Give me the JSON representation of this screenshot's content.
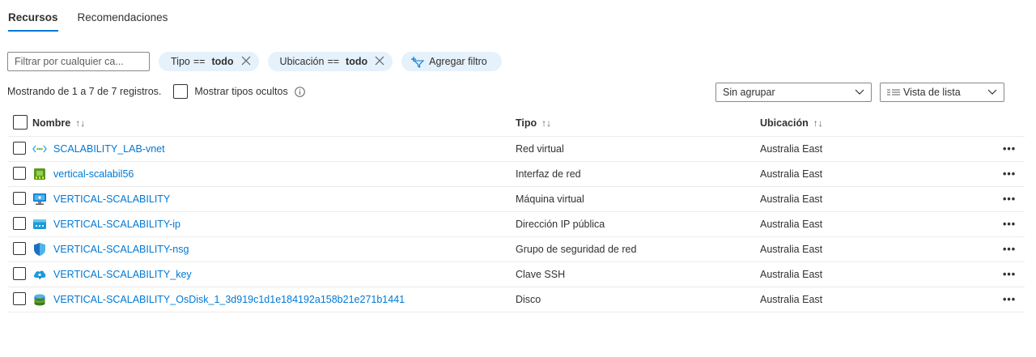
{
  "tabs": [
    {
      "label": "Recursos",
      "active": true
    },
    {
      "label": "Recomendaciones",
      "active": false
    }
  ],
  "filters": {
    "search_placeholder": "Filtrar por cualquier ca...",
    "pills": [
      {
        "key": "Tipo",
        "op": "==",
        "value": "todo"
      },
      {
        "key": "Ubicación",
        "op": "==",
        "value": "todo"
      }
    ],
    "add_filter_label": "Agregar filtro"
  },
  "summary": {
    "count_text": "Mostrando de 1 a 7 de 7 registros.",
    "show_hidden_label": "Mostrar tipos ocultos"
  },
  "grouping": {
    "selected": "Sin agrupar"
  },
  "view": {
    "selected": "Vista de lista"
  },
  "table": {
    "columns": [
      {
        "label": "Nombre",
        "sort": "↑↓"
      },
      {
        "label": "Tipo",
        "sort": "↑↓"
      },
      {
        "label": "Ubicación",
        "sort": "↑↓"
      }
    ],
    "rows": [
      {
        "name": "SCALABILITY_LAB-vnet",
        "type": "Red virtual",
        "location": "Australia East",
        "icon": "virtual-network-icon",
        "more": "•••"
      },
      {
        "name": "vertical-scalabil56",
        "type": "Interfaz de red",
        "location": "Australia East",
        "icon": "network-interface-icon",
        "more": "•••"
      },
      {
        "name": "VERTICAL-SCALABILITY",
        "type": "Máquina virtual",
        "location": "Australia East",
        "icon": "virtual-machine-icon",
        "more": "•••"
      },
      {
        "name": "VERTICAL-SCALABILITY-ip",
        "type": "Dirección IP pública",
        "location": "Australia East",
        "icon": "public-ip-icon",
        "more": "•••"
      },
      {
        "name": "VERTICAL-SCALABILITY-nsg",
        "type": "Grupo de seguridad de red",
        "location": "Australia East",
        "icon": "network-security-group-icon",
        "more": "•••"
      },
      {
        "name": "VERTICAL-SCALABILITY_key",
        "type": "Clave SSH",
        "location": "Australia East",
        "icon": "ssh-key-icon",
        "more": "•••"
      },
      {
        "name": "VERTICAL-SCALABILITY_OsDisk_1_3d919c1d1e184192a158b21e271b1441",
        "type": "Disco",
        "location": "Australia East",
        "icon": "disk-icon",
        "more": "•••"
      }
    ]
  },
  "colors": {
    "accent": "#0078d4",
    "pill_bg": "#e5f1fb",
    "text": "#323130"
  }
}
